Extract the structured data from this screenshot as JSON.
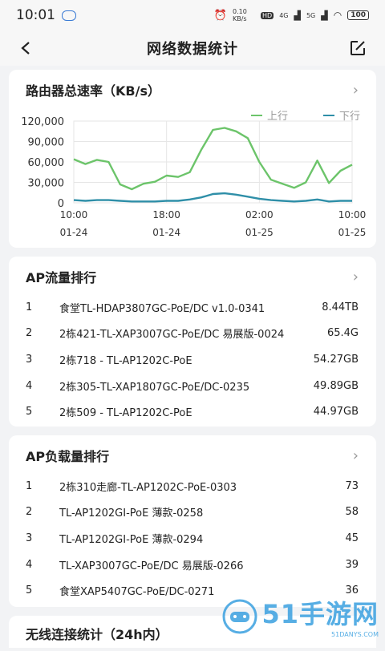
{
  "status_bar": {
    "time": "10:01",
    "net_speed": "0.10 KB/s",
    "hd": "HD",
    "net1": "4G",
    "net2": "5G",
    "battery": "100"
  },
  "header": {
    "title": "网络数据统计"
  },
  "router_speed": {
    "title": "路由器总速率（KB/s）",
    "legend": [
      "上行",
      "下行"
    ]
  },
  "chart_data": {
    "type": "line",
    "title": "路由器总速率（KB/s）",
    "x_ticks": [
      {
        "time": "10:00",
        "date": "01-24"
      },
      {
        "time": "18:00",
        "date": "01-24"
      },
      {
        "time": "02:00",
        "date": "01-25"
      },
      {
        "time": "10:00",
        "date": "01-25"
      }
    ],
    "x": [
      "01-24 10:00",
      "01-24 11:00",
      "01-24 12:00",
      "01-24 13:00",
      "01-24 14:00",
      "01-24 15:00",
      "01-24 16:00",
      "01-24 17:00",
      "01-24 18:00",
      "01-24 19:00",
      "01-24 20:00",
      "01-24 21:00",
      "01-24 22:00",
      "01-24 23:00",
      "01-25 00:00",
      "01-25 01:00",
      "01-25 02:00",
      "01-25 03:00",
      "01-25 04:00",
      "01-25 05:00",
      "01-25 06:00",
      "01-25 07:00",
      "01-25 08:00",
      "01-25 09:00",
      "01-25 10:00"
    ],
    "ylim": [
      0,
      120000
    ],
    "y_ticks": [
      "120,000",
      "90,000",
      "60,000",
      "30,000",
      "0"
    ],
    "series": [
      {
        "name": "上行",
        "color": "#6cc46a",
        "values": [
          64000,
          57000,
          63000,
          60000,
          27000,
          20000,
          28000,
          31000,
          40000,
          38000,
          45000,
          78000,
          107000,
          110000,
          105000,
          95000,
          60000,
          34000,
          28000,
          22000,
          30000,
          62000,
          29000,
          47000,
          56000
        ]
      },
      {
        "name": "下行",
        "color": "#2f8fa8",
        "values": [
          4000,
          3000,
          4000,
          4000,
          3000,
          2000,
          2000,
          2000,
          3000,
          3000,
          5000,
          8000,
          13000,
          14000,
          12000,
          9000,
          6000,
          4000,
          3000,
          2000,
          3000,
          5000,
          2000,
          3000,
          3000
        ]
      }
    ]
  },
  "ap_traffic": {
    "title": "AP流量排行",
    "rows": [
      {
        "rank": "1",
        "name": "食堂TL-HDAP3807GC-PoE/DC v1.0-0341",
        "value": "8.44TB"
      },
      {
        "rank": "2",
        "name": "2栋421-TL-XAP3007GC-PoE/DC 易展版-0024",
        "value": "65.4G"
      },
      {
        "rank": "3",
        "name": "2栋718 - TL-AP1202C-PoE",
        "value": "54.27GB"
      },
      {
        "rank": "4",
        "name": "2栋305-TL-XAP1807GC-PoE/DC-0235",
        "value": "49.89GB"
      },
      {
        "rank": "5",
        "name": "2栋509 - TL-AP1202C-PoE",
        "value": "44.97GB"
      }
    ]
  },
  "ap_load": {
    "title": "AP负载量排行",
    "rows": [
      {
        "rank": "1",
        "name": "2栋310走廊-TL-AP1202C-PoE-0303",
        "value": "73"
      },
      {
        "rank": "2",
        "name": "TL-AP1202GI-PoE 薄款-0258",
        "value": "58"
      },
      {
        "rank": "3",
        "name": "TL-AP1202GI-PoE 薄款-0294",
        "value": "45"
      },
      {
        "rank": "4",
        "name": "TL-XAP3007GC-PoE/DC 易展版-0266",
        "value": "39"
      },
      {
        "rank": "5",
        "name": "食堂XAP5407GC-PoE/DC-0271",
        "value": "36"
      }
    ]
  },
  "wireless": {
    "title": "无线连接统计（24h内）"
  },
  "watermark": {
    "text": "51手游网",
    "sub": "51DANYS.COM"
  },
  "colors": {
    "upload": "#6cc46a",
    "download": "#2f8fa8",
    "grid": "#e6e6e6"
  }
}
